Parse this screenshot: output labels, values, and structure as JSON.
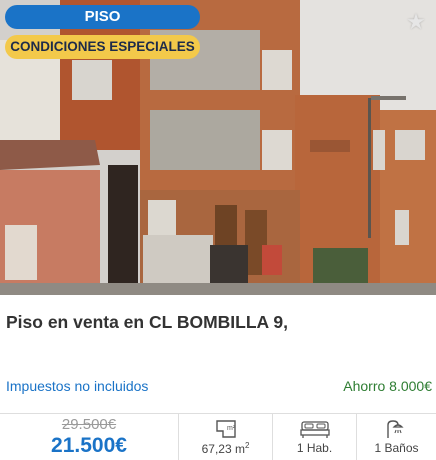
{
  "listing": {
    "type_badge": "PISO",
    "special_badge": "CONDICIONES ESPECIALES",
    "favorite_icon": "star-icon",
    "title": "Piso en venta en CL BOMBILLA 9,",
    "taxes_note": "Impuestos no incluidos",
    "saving": "Ahorro 8.000€",
    "old_price": "29.500€",
    "new_price": "21.500€",
    "area": "67,23 m",
    "area_unit_sup": "2",
    "rooms": "1 Hab.",
    "baths": "1 Baños"
  },
  "colors": {
    "type_badge": "#1a73c7",
    "special_badge": "#f3c94a",
    "price": "#1a73c7",
    "saving": "#2e7d32"
  }
}
